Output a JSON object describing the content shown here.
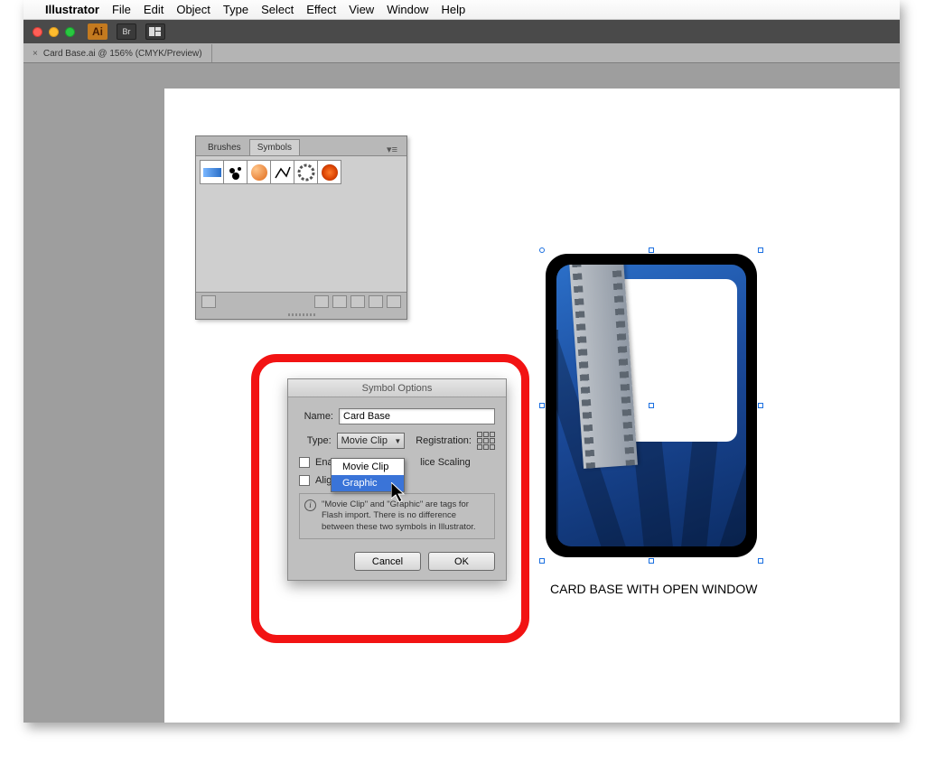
{
  "menubar": {
    "app": "Illustrator",
    "items": [
      "File",
      "Edit",
      "Object",
      "Type",
      "Select",
      "Effect",
      "View",
      "Window",
      "Help"
    ]
  },
  "toolbar": {
    "br_label": "Br"
  },
  "tab": {
    "close": "×",
    "title": "Card Base.ai @ 156% (CMYK/Preview)"
  },
  "symbols_panel": {
    "tab_brushes": "Brushes",
    "tab_symbols": "Symbols"
  },
  "dialog": {
    "title": "Symbol Options",
    "name_label": "Name:",
    "name_value": "Card Base",
    "type_label": "Type:",
    "type_value": "Movie Clip",
    "registration_label": "Registration:",
    "chk_guides": "Enable Guides for 9-Slice Scaling",
    "chk_guides_short": "Enabl",
    "chk_guides_tail": "lice Scaling",
    "chk_pixel": "Align to Pixel Grid",
    "chk_pixel_short": "Align",
    "info": "\"Movie Clip\" and \"Graphic\" are tags for Flash import. There is no difference between these two symbols in Illustrator.",
    "cancel": "Cancel",
    "ok": "OK",
    "dd_movie": "Movie Clip",
    "dd_graphic": "Graphic"
  },
  "caption": "CARD BASE WITH OPEN WINDOW"
}
